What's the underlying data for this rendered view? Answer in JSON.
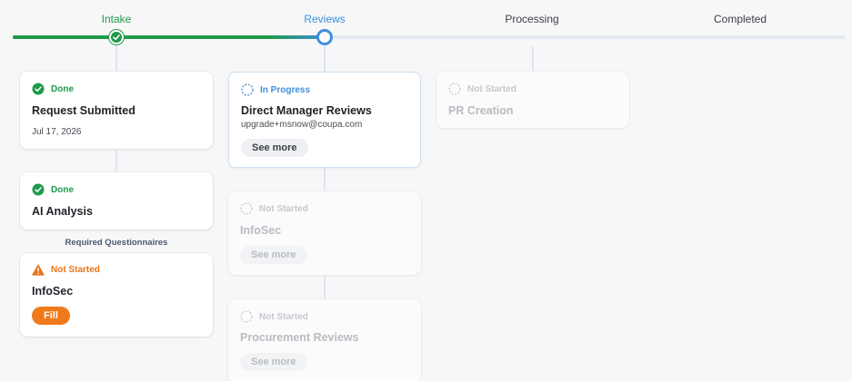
{
  "stages": [
    {
      "label": "Intake"
    },
    {
      "label": "Reviews"
    },
    {
      "label": "Processing"
    },
    {
      "label": "Completed"
    }
  ],
  "intake": {
    "request_card": {
      "status": "Done",
      "title": "Request Submitted",
      "date": "Jul 17, 2026"
    },
    "ai_card": {
      "status": "Done",
      "title": "AI Analysis"
    },
    "questionnaires_label": "Required Questionnaires",
    "infosec_card": {
      "status": "Not Started",
      "title": "InfoSec",
      "button": "Fill"
    }
  },
  "reviews": {
    "manager_card": {
      "status": "In Progress",
      "title": "Direct Manager Reviews",
      "email": "upgrade+msnow@coupa.com",
      "button": "See more"
    },
    "infosec_card": {
      "status": "Not Started",
      "title": "InfoSec",
      "button": "See more"
    },
    "procurement_card": {
      "status": "Not Started",
      "title": "Procurement Reviews",
      "button": "See more"
    }
  },
  "processing": {
    "pr_card": {
      "status": "Not Started",
      "title": "PR Creation"
    }
  },
  "colors": {
    "done": "#1e9a4b",
    "in_progress": "#3f8fd8",
    "warning": "#e8751a",
    "fill_button": "#ef7a1a",
    "not_started": "#c4c8cd"
  }
}
